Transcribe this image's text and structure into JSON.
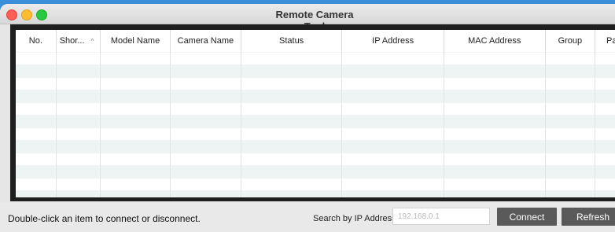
{
  "window": {
    "title": "Remote Camera Tool"
  },
  "table": {
    "columns": [
      {
        "key": "no",
        "label": "No.",
        "width": 49
      },
      {
        "key": "short",
        "label": "Shor...",
        "width": 54,
        "sorted": true,
        "sort_icon": "^"
      },
      {
        "key": "model",
        "label": "Model Name",
        "width": 85
      },
      {
        "key": "camera",
        "label": "Camera Name",
        "width": 86
      },
      {
        "key": "status",
        "label": "Status",
        "width": 123
      },
      {
        "key": "ip",
        "label": "IP Address",
        "width": 124
      },
      {
        "key": "mac",
        "label": "MAC Address",
        "width": 123
      },
      {
        "key": "group",
        "label": "Group",
        "width": 61
      },
      {
        "key": "pairing",
        "label": "Pairing",
        "width": 60
      }
    ],
    "empty_rows": 12
  },
  "statusbar": {
    "hint": "Double-click an item to connect or disconnect.",
    "search_label": "Search by IP Address",
    "search_placeholder": "192.168.0.1",
    "search_value": "",
    "connect_label": "Connect",
    "refresh_label": "Refresh"
  },
  "colors": {
    "desktop_accent": "#3a8fd8",
    "button_bg": "#5a5a5a",
    "row_alt": "#eef3f3"
  }
}
